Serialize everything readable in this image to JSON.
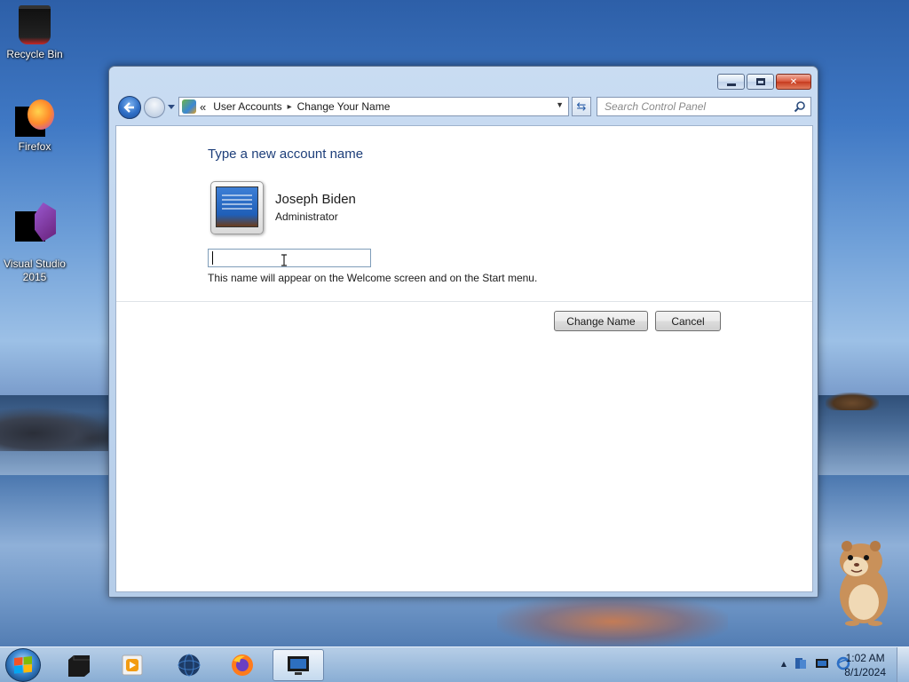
{
  "desktop": {
    "icons": [
      {
        "label": "Recycle Bin"
      },
      {
        "label": "Firefox"
      },
      {
        "label": "Visual Studio\n2015"
      }
    ]
  },
  "window": {
    "minimize_icon": "minimize-icon",
    "maximize_icon": "maximize-icon",
    "close_label": "✕",
    "nav": {
      "back_icon": "back-arrow-icon",
      "forward_icon": "forward-arrow-icon",
      "overflow": "«",
      "breadcrumb": [
        "User Accounts",
        "Change Your Name"
      ],
      "separator": "▸",
      "refresh_symbol": "⇆",
      "search_placeholder": "Search Control Panel"
    },
    "content": {
      "heading": "Type a new account name",
      "user_name": "Joseph Biden",
      "user_role": "Administrator",
      "name_input_value": "",
      "hint": "This name will appear on the Welcome screen and on the Start menu.",
      "change_button": "Change Name",
      "cancel_button": "Cancel"
    }
  },
  "taskbar": {
    "pinned": [
      "window-manager-icon",
      "media-player-icon",
      "globe-icon",
      "firefox-icon",
      "control-panel-icon"
    ],
    "active_index": 4,
    "clock_time": "1:02 AM",
    "clock_date": "8/1/2024",
    "tray_expand": "▲"
  },
  "colors": {
    "heading_blue": "#1e3f7a",
    "accent": "#2f6fc6"
  }
}
